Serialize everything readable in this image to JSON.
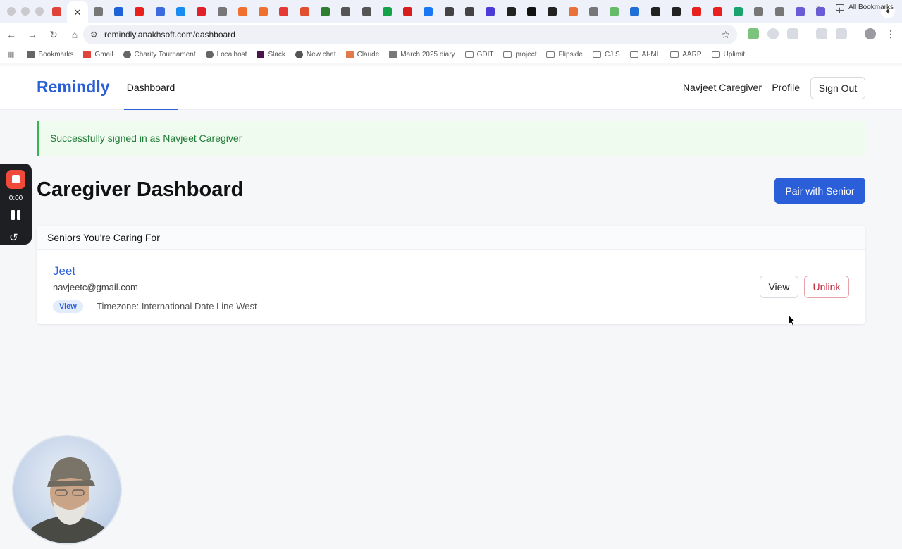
{
  "browser": {
    "url": "remindly.anakhsoft.com/dashboard",
    "tab_favicons": [
      "#e0433a",
      "#ffffff",
      "#777777",
      "#1d62d6",
      "#e8201e",
      "#3b6bdc",
      "#1b8cef",
      "#e0202a",
      "#777777",
      "#f07030",
      "#f07030",
      "#e53935",
      "#e05030",
      "#2e7d32",
      "#555555",
      "#555555",
      "#15a34a",
      "#d81d1d",
      "#1877f2",
      "#444444",
      "#444444",
      "#4c3bd6",
      "#222222",
      "#111111",
      "#222222",
      "#e8703a",
      "#777777",
      "#66bb6a",
      "#1f6fd6",
      "#222222",
      "#222222",
      "#e8201e",
      "#e8201e",
      "#1aa36e",
      "#777777",
      "#777777",
      "#6a5bd6",
      "#6a5bd6"
    ],
    "bookmarks": [
      {
        "label": "Bookmarks",
        "icon": "star-icon"
      },
      {
        "label": "Gmail",
        "icon": "gmail-icon"
      },
      {
        "label": "Charity Tournament",
        "icon": "drive-icon"
      },
      {
        "label": "Localhost",
        "icon": "drive-icon"
      },
      {
        "label": "Slack",
        "icon": "slack-icon"
      },
      {
        "label": "New chat",
        "icon": "openai-icon"
      },
      {
        "label": "Claude",
        "icon": "claude-icon"
      },
      {
        "label": "March 2025 diary",
        "icon": "page-icon"
      },
      {
        "label": "GDIT",
        "icon": "folder-icon"
      },
      {
        "label": "project",
        "icon": "folder-icon"
      },
      {
        "label": "Flipside",
        "icon": "folder-icon"
      },
      {
        "label": "CJIS",
        "icon": "folder-icon"
      },
      {
        "label": "AI-ML",
        "icon": "folder-icon"
      },
      {
        "label": "AARP",
        "icon": "folder-icon"
      },
      {
        "label": "Uplimit",
        "icon": "folder-icon"
      }
    ],
    "all_bookmarks": "All Bookmarks"
  },
  "app": {
    "brand": "Remindly",
    "nav_dashboard": "Dashboard",
    "user_name": "Navjeet Caregiver",
    "profile": "Profile",
    "sign_out": "Sign Out",
    "alert": "Successfully signed in as Navjeet Caregiver",
    "title": "Caregiver Dashboard",
    "pair_button": "Pair with Senior",
    "seniors_header": "Seniors You're Caring For",
    "seniors": [
      {
        "name": "Jeet",
        "email": "navjeetc@gmail.com",
        "badge": "View",
        "timezone": "Timezone: International Date Line West",
        "view_label": "View",
        "unlink_label": "Unlink"
      }
    ],
    "colors": {
      "accent": "#2b5fd9",
      "success": "#3cb256",
      "danger": "#c0253a"
    }
  },
  "recorder": {
    "time": "0:00"
  }
}
